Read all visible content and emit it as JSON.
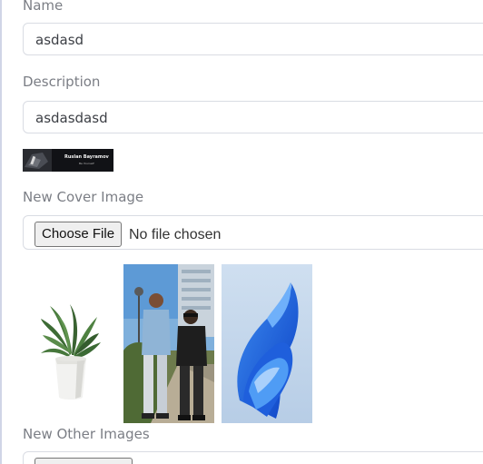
{
  "form": {
    "name_label": "Name",
    "name_value": "asdasd",
    "description_label": "Description",
    "description_value": "asdasdasd",
    "cover_thumbnail": {
      "line1": "Ruslan Bayramov",
      "line2": "Be Yourself"
    },
    "new_cover_label": "New Cover Image",
    "cover_file_button": "Choose File",
    "cover_file_status": "No file chosen",
    "other_images": [
      {
        "name": "plant-image"
      },
      {
        "name": "people-photo"
      },
      {
        "name": "blue-swirl-wallpaper"
      }
    ],
    "new_other_label": "New Other Images"
  },
  "colors": {
    "label": "#7b7e85",
    "input_border": "#d9dce3",
    "input_text": "#3c3f45",
    "page_background": "#ffffff"
  }
}
